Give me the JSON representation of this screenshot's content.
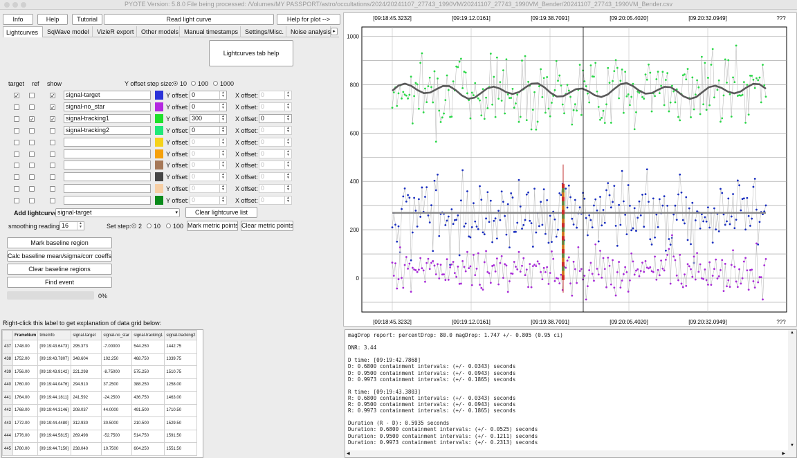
{
  "window": {
    "title": "PYOTE Version: 5.8.0  File being processed: /Volumes/MY PASSPORT/astro/occultations/2024/20241107_27743_1990VM/20241107_27743_1990VM_Bender/20241107_27743_1990VM_Bender.csv"
  },
  "toolbar": {
    "info": "Info",
    "help": "Help",
    "tutorial": "Tutorial",
    "read_lightcurve": "Read light curve",
    "help_plot": "Help for plot -->"
  },
  "tabs": [
    "Lightcurves",
    "SqWave model",
    "VizieR export",
    "Other models",
    "Manual timestamps",
    "Settings/Misc.",
    "Noise analysis/"
  ],
  "tab_help": "Lightcurves tab help",
  "headers": {
    "target": "target",
    "ref": "ref",
    "show": "show",
    "yoffset_step": "Y offset step size:"
  },
  "yoffset_steps": [
    {
      "label": "10",
      "on": true
    },
    {
      "label": "100",
      "on": false
    },
    {
      "label": "1000",
      "on": false
    }
  ],
  "row_labels": {
    "y": "Y offset:",
    "x": "X offset:"
  },
  "curves": [
    {
      "name": "signal-target",
      "color": "#2a32d8",
      "target": true,
      "ref": false,
      "show": true,
      "y": "0",
      "x": "0",
      "enabled": true
    },
    {
      "name": "signal-no_star",
      "color": "#b428e0",
      "target": false,
      "ref": false,
      "show": true,
      "y": "0",
      "x": "0",
      "enabled": true
    },
    {
      "name": "signal-tracking1",
      "color": "#1ee02a",
      "target": false,
      "ref": true,
      "show": true,
      "y": "300",
      "x": "0",
      "enabled": true
    },
    {
      "name": "signal-tracking2",
      "color": "#20e878",
      "target": false,
      "ref": false,
      "show": false,
      "y": "0",
      "x": "0",
      "enabled": true
    },
    {
      "name": "",
      "color": "#f5d21a",
      "target": false,
      "ref": false,
      "show": false,
      "y": "0",
      "x": "0",
      "enabled": false
    },
    {
      "name": "",
      "color": "#f5a00a",
      "target": false,
      "ref": false,
      "show": false,
      "y": "0",
      "x": "0",
      "enabled": false
    },
    {
      "name": "",
      "color": "#a57858",
      "target": false,
      "ref": false,
      "show": false,
      "y": "0",
      "x": "0",
      "enabled": false
    },
    {
      "name": "",
      "color": "#454545",
      "target": false,
      "ref": false,
      "show": false,
      "y": "0",
      "x": "0",
      "enabled": false
    },
    {
      "name": "",
      "color": "#f7cfa5",
      "target": false,
      "ref": false,
      "show": false,
      "y": "0",
      "x": "0",
      "enabled": false
    },
    {
      "name": "",
      "color": "#0a8a1a",
      "target": false,
      "ref": false,
      "show": false,
      "y": "0",
      "x": "0",
      "enabled": false
    }
  ],
  "add_lightcurve": {
    "label": "Add lightcurve",
    "value": "signal-target",
    "clear": "Clear lightcurve list"
  },
  "smoothing": {
    "label": "smoothing readings",
    "value": "16"
  },
  "set_step": {
    "label": "Set step:",
    "options": [
      {
        "label": "2",
        "on": true
      },
      {
        "label": "10",
        "on": false
      },
      {
        "label": "100",
        "on": false
      }
    ]
  },
  "metric": {
    "mark": "Mark metric points",
    "clear": "Clear metric points"
  },
  "actions": {
    "mark_baseline": "Mark baseline region",
    "calc_baseline": "Calc baseline mean/sigma/corr coeffs",
    "clear_baseline": "Clear baseline regions",
    "find_event": "Find event"
  },
  "progress": {
    "value": 0,
    "label": "0%"
  },
  "grid_hint": "Right-click this label to get explanation of data grid below:",
  "plot": {
    "top_ticks": [
      "[09:18:45.3232]",
      "[09:19:12.0161]",
      "[09:19:38.7091]",
      "[09:20:05.4020]",
      "[09:20:32.0949]",
      "???"
    ],
    "bottom_ticks": [
      "[09:18:45.3232]",
      "[09:19:12.0161]",
      "[09:19:38.7091]",
      "[09:20:05.4020]",
      "[09:20:32.0949]",
      "???"
    ],
    "y_ticks": [
      "1000",
      "800",
      "600",
      "400",
      "200",
      "0"
    ],
    "colors": {
      "target": "#1a2fc0",
      "no_star": "#a82ad8",
      "tracking": "#2bd848",
      "smooth": "#5a5a5a",
      "baseline": "#8a8a8a"
    }
  },
  "grid": {
    "columns": [
      "",
      "FrameNum",
      "timeInfo",
      "signal-target",
      "signal-no_star",
      "signal-tracking1",
      "signal-tracking2"
    ],
    "rows": [
      [
        "437",
        "1748.00",
        "[09:19:43.6473]",
        "295.373",
        "-7.00000",
        "544.250",
        "1442.75"
      ],
      [
        "438",
        "1752.00",
        "[09:19:43.7807]",
        "348.604",
        "102.250",
        "468.750",
        "1339.75"
      ],
      [
        "439",
        "1756.00",
        "[09:19:43.9142]",
        "221.298",
        "-8.75000",
        "575.250",
        "1510.75"
      ],
      [
        "440",
        "1760.00",
        "[09:19:44.0476]",
        "294.910",
        "37.2500",
        "388.250",
        "1258.00"
      ],
      [
        "441",
        "1764.00",
        "[09:19:44.1811]",
        "241.592",
        "-24.2500",
        "436.750",
        "1463.00"
      ],
      [
        "442",
        "1768.00",
        "[09:19:44.3146]",
        "208.037",
        "44.0000",
        "491.500",
        "1710.50"
      ],
      [
        "443",
        "1772.00",
        "[09:19:44.4480]",
        "312.930",
        "30.5000",
        "210.500",
        "1529.50"
      ],
      [
        "444",
        "1776.00",
        "[09:19:44.5815]",
        "269.498",
        "-52.7500",
        "514.750",
        "1591.50"
      ],
      [
        "445",
        "1780.00",
        "[09:19:44.7150]",
        "238.040",
        "10.7500",
        "604.250",
        "1551.50"
      ]
    ]
  },
  "report": "magDrop report: percentDrop: 80.0 magDrop: 1.747 +/- 0.805 (0.95 ci)\n\nDNR: 3.44\n\nD time: [09:19:42.7868]\nD: 0.6800 containment intervals: (+/- 0.0343) seconds\nD: 0.9500 containment intervals: (+/- 0.0943) seconds\nD: 0.9973 containment intervals: (+/- 0.1865) seconds\n\nR time: [09:19:43.3803]\nR: 0.6800 containment intervals: (+/- 0.0343) seconds\nR: 0.9500 containment intervals: (+/- 0.0943) seconds\nR: 0.9973 containment intervals: (+/- 0.1865) seconds\n\nDuration (R - D): 0.5935 seconds\nDuration: 0.6800 containment intervals: (+/- 0.0525) seconds\nDuration: 0.9500 containment intervals: (+/- 0.1211) seconds\nDuration: 0.9973 containment intervals: (+/- 0.2313) seconds"
}
